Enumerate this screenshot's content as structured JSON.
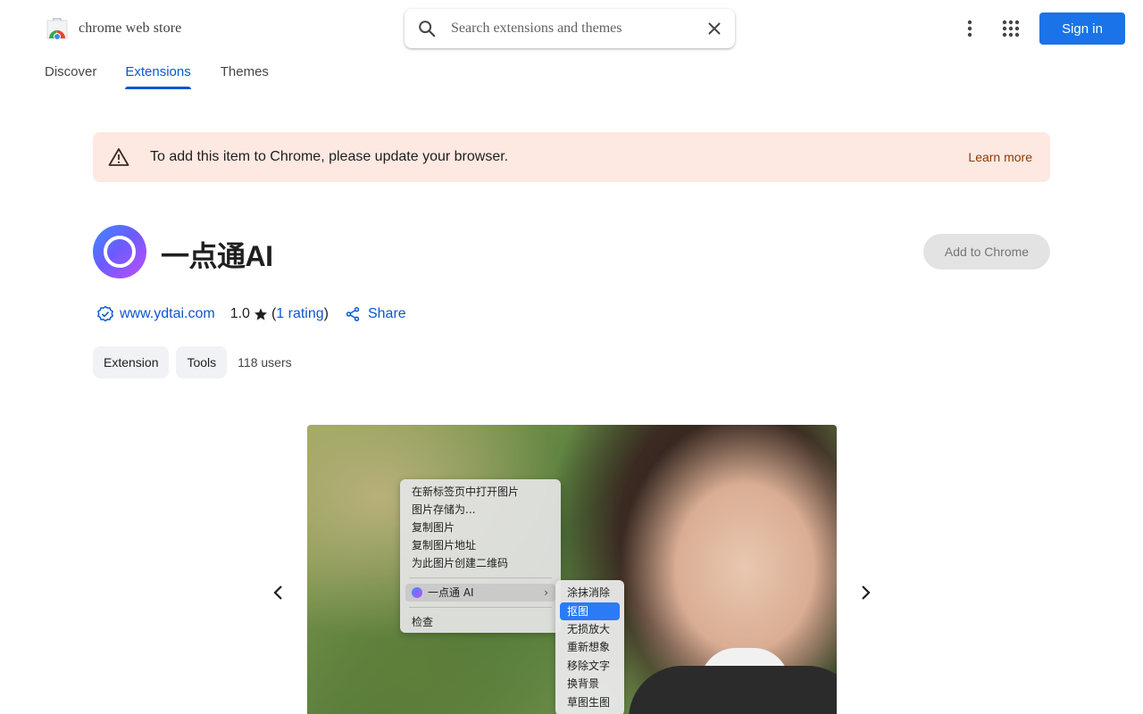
{
  "header": {
    "logo_text": "chrome web store",
    "search_placeholder": "Search extensions and themes",
    "signin_label": "Sign in"
  },
  "tabs": [
    {
      "label": "Discover",
      "active": false
    },
    {
      "label": "Extensions",
      "active": true
    },
    {
      "label": "Themes",
      "active": false
    }
  ],
  "banner": {
    "message": "To add this item to Chrome, please update your browser.",
    "link": "Learn more"
  },
  "item": {
    "title": "一点通AI",
    "add_button": "Add to Chrome",
    "site": "www.ydtai.com",
    "rating_value": "1.0",
    "rating_open": "(",
    "rating_link": "1 rating",
    "rating_close": ")",
    "share_label": "Share",
    "chips": [
      "Extension",
      "Tools"
    ],
    "users": "118 users"
  },
  "screenshot": {
    "context_menu": [
      "在新标签页中打开图片",
      "图片存储为...",
      "复制图片",
      "复制图片地址",
      "为此图片创建二维码"
    ],
    "highlighted_item": "一点通 AI",
    "last_item": "检查",
    "submenu": [
      "涂抹消除",
      "抠图",
      "无损放大",
      "重新想象",
      "移除文字",
      "换背景",
      "草图生图"
    ],
    "submenu_selected_index": 1
  },
  "colors": {
    "accent": "#0b57d0",
    "signin_bg": "#1a73e8",
    "banner_bg": "#fde9e2",
    "banner_link": "#8f3a00"
  },
  "icons": [
    "chrome-web-store-logo",
    "search-icon",
    "close-icon",
    "more-vert-icon",
    "apps-grid-icon",
    "warning-icon",
    "verified-icon",
    "star-icon",
    "share-icon",
    "chevron-left-icon",
    "chevron-right-icon"
  ]
}
